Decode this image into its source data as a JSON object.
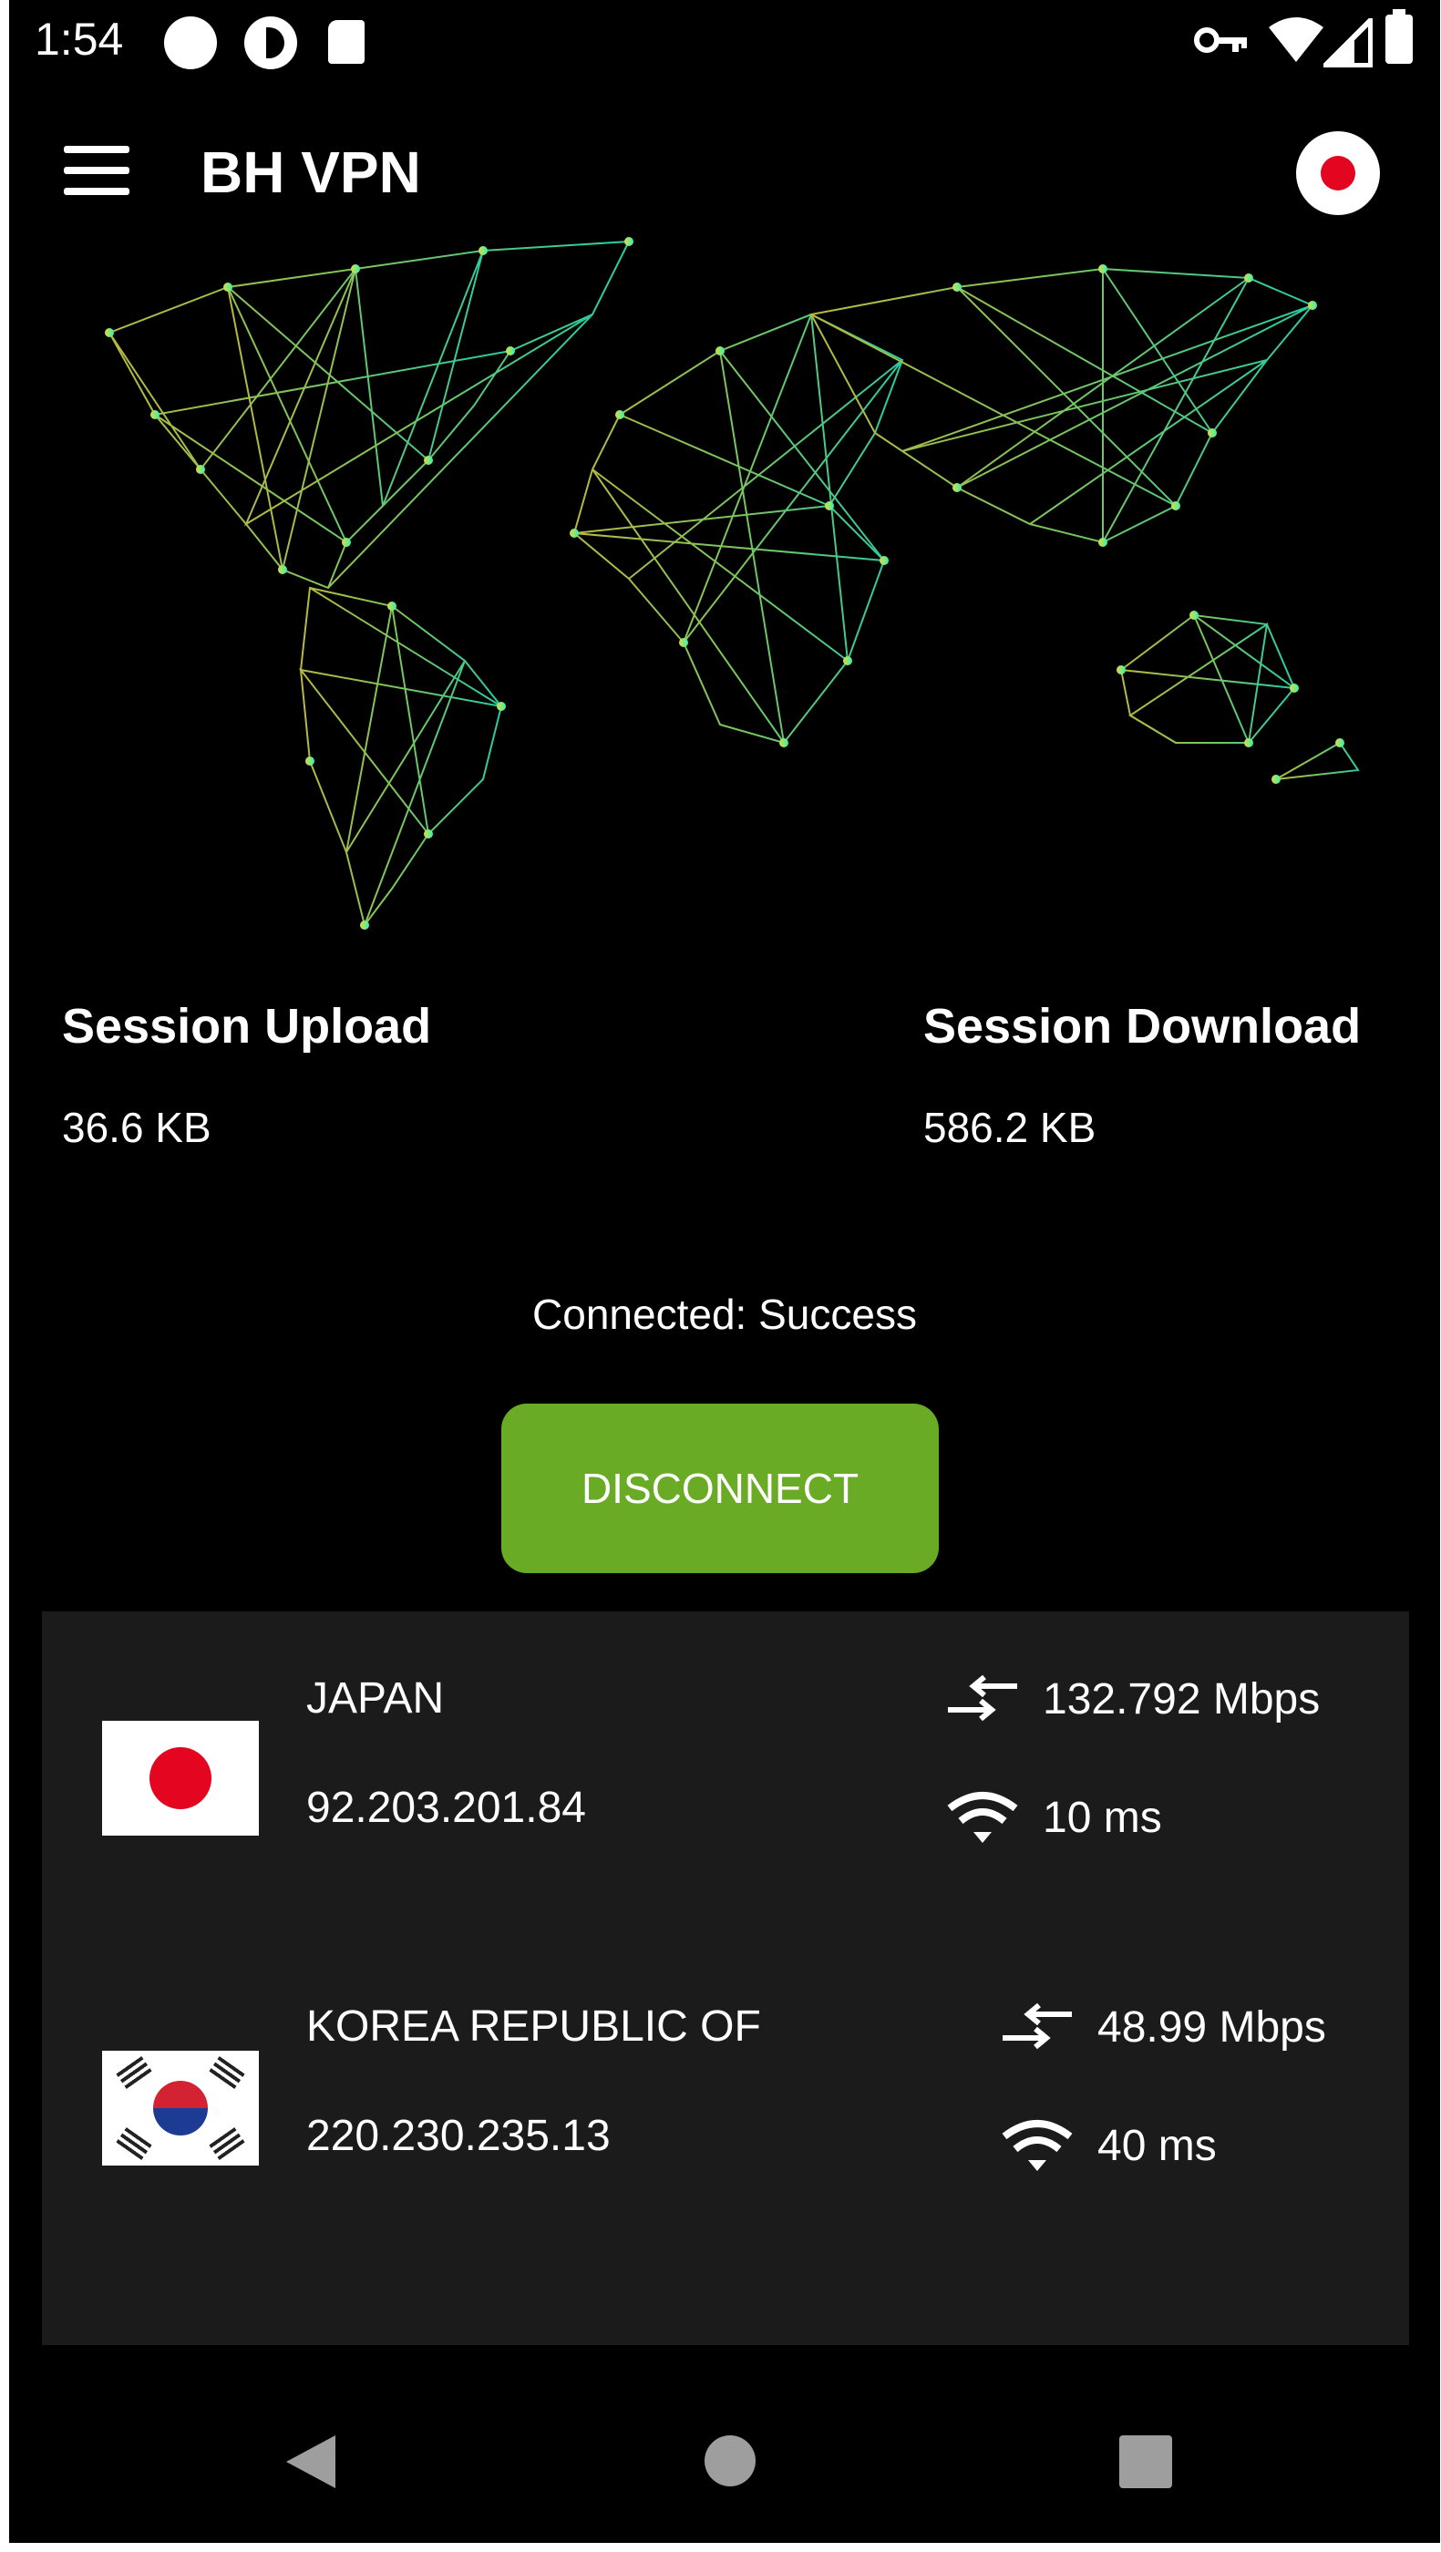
{
  "status_bar": {
    "time": "1:54",
    "icons": [
      "dot-icon",
      "data-saver-icon",
      "sd-card-icon",
      "vpn-key-icon",
      "wifi-icon",
      "signal-icon",
      "battery-icon"
    ]
  },
  "toolbar": {
    "menu_icon": "hamburger-menu-icon",
    "title": "BH VPN",
    "selected_flag": "japan-flag-icon"
  },
  "map": {
    "icon": "world-network-map",
    "colors": [
      "#d9d94a",
      "#2ef0c0"
    ]
  },
  "stats": {
    "upload_label": "Session Upload",
    "upload_value": "36.6 KB",
    "download_label": "Session Download",
    "download_value": "586.2 KB"
  },
  "connection": {
    "status": "Connected: Success",
    "disconnect_label": "DISCONNECT",
    "button_color": "#6aab25"
  },
  "servers": [
    {
      "country": "JAPAN",
      "ip": "92.203.201.84",
      "speed": "132.792 Mbps",
      "ping": "10 ms",
      "flag": "japan-flag-icon"
    },
    {
      "country": "KOREA REPUBLIC OF",
      "ip": "220.230.235.13",
      "speed": "48.99 Mbps",
      "ping": "40 ms",
      "flag": "south-korea-flag-icon"
    }
  ],
  "nav": {
    "icons": [
      "back-icon",
      "home-icon",
      "recents-icon"
    ]
  }
}
